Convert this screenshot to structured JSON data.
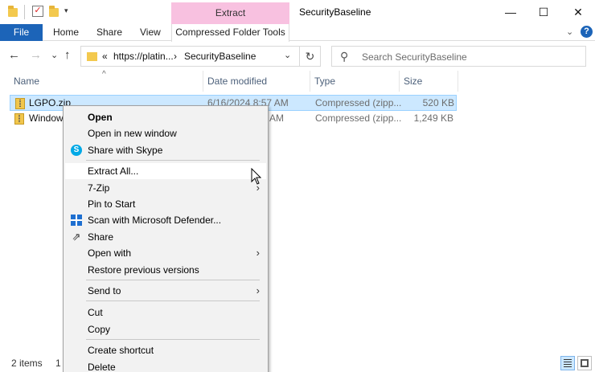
{
  "window": {
    "title": "SecurityBaseline",
    "context_tab": "Extract",
    "controls": {
      "minimize": "—",
      "maximize": "☐",
      "close": "✕"
    }
  },
  "ribbon": {
    "file": "File",
    "tabs": [
      "Home",
      "Share",
      "View"
    ],
    "context_tools": "Compressed Folder Tools",
    "collapse": "⌄",
    "help": "?"
  },
  "nav": {
    "back": "←",
    "forward": "→",
    "recent": "⌄",
    "up": "↑",
    "address_overflow": "«",
    "address_parts": [
      "https://platin...",
      "SecurityBaseline"
    ],
    "address_sep": "›",
    "address_dropdown": "⌄",
    "refresh": "↻",
    "search_placeholder": "Search SecurityBaseline"
  },
  "columns": [
    "Name",
    "Date modified",
    "Type",
    "Size"
  ],
  "sort_indicator": "^",
  "files": [
    {
      "name": "LGPO.zip",
      "date": "6/16/2024 8:57 AM",
      "type": "Compressed (zipp...",
      "size": "520 KB",
      "selected": true
    },
    {
      "name": "Window",
      "date": "AM",
      "type": "Compressed (zipp...",
      "size": "1,249 KB",
      "selected": false
    }
  ],
  "status": {
    "items": "2 items",
    "selected_fragment": "1"
  },
  "context_menu": {
    "items": [
      {
        "label": "Open",
        "bold": true
      },
      {
        "label": "Open in new window"
      },
      {
        "label": "Share with Skype",
        "icon": "skype-icon"
      },
      {
        "label": "Extract All...",
        "hover": true
      },
      {
        "label": "7-Zip",
        "submenu": true
      },
      {
        "label": "Pin to Start"
      },
      {
        "label": "Scan with Microsoft Defender...",
        "icon": "defender-icon"
      },
      {
        "label": "Share",
        "icon": "share-icon"
      },
      {
        "label": "Open with",
        "submenu": true
      },
      {
        "label": "Restore previous versions"
      },
      {
        "label": "Send to",
        "submenu": true
      },
      {
        "label": "Cut"
      },
      {
        "label": "Copy"
      },
      {
        "label": "Create shortcut"
      },
      {
        "label": "Delete"
      }
    ],
    "submenu_arrow": "›",
    "skype_glyph": "S",
    "share_glyph": "⇗"
  },
  "colors": {
    "accent": "#1c64b8",
    "extract_tab": "#f8c1e0",
    "selection": "#cce8ff",
    "menu_bg": "#f2f2f2"
  }
}
